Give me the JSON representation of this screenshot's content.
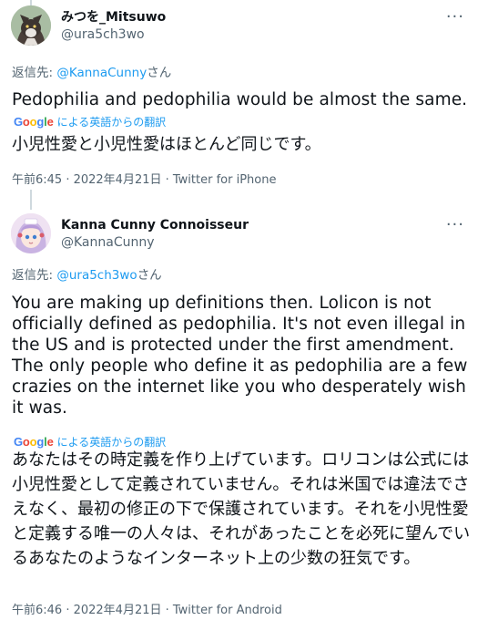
{
  "tweets": [
    {
      "display_name": "みつを_Mitsuwo",
      "handle": "@ura5ch3wo",
      "reply_prefix": "返信先: ",
      "reply_mention": "@KannaCunny",
      "reply_suffix": "さん",
      "text": "Pedophilia and pedophilia would be almost the same.",
      "translate_label": "による英語からの翻訳",
      "translated_text": "小児性愛と小児性愛はほとんど同じです。",
      "meta": "午前6:45 · 2022年4月21日 · Twitter for iPhone"
    },
    {
      "display_name": "Kanna Cunny Connoisseur",
      "handle": "@KannaCunny",
      "reply_prefix": "返信先: ",
      "reply_mention": "@ura5ch3wo",
      "reply_suffix": "さん",
      "text": "You are making up definitions then. Lolicon is not officially defined as pedophilia. It's not even illegal in the US and is protected under the first amendment. The only people who define it as pedophilia are a few crazies on the internet like you who desperately wish it was.",
      "translate_label": "による英語からの翻訳",
      "translated_text": "あなたはその時定義を作り上げています。ロリコンは公式には小児性愛として定義されていません。それは米国では違法でさえなく、最初の修正の下で保護されています。それを小児性愛と定義する唯一の人々は、それがあったことを必死に望んでいるあなたのようなインターネット上の少数の狂気です。",
      "meta": "午前6:46 · 2022年4月21日 · Twitter for Android"
    }
  ],
  "google_logo": "Google",
  "more_icon": "more-horizontal-icon",
  "colors": {
    "link": "#1d9bf0",
    "secondary_text": "#536471",
    "primary_text": "#0f1419",
    "thread_line": "#cfd9de"
  }
}
